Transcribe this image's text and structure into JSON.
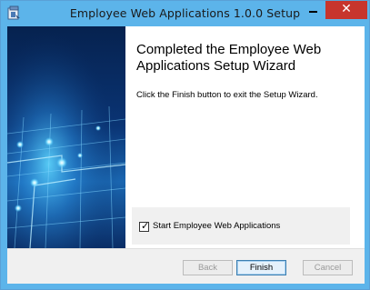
{
  "window": {
    "title": "Employee Web Applications 1.0.0 Setup",
    "close_symbol": "✕"
  },
  "content": {
    "title": "Completed the Employee Web Applications Setup Wizard",
    "description": "Click the Finish button to exit the Setup Wizard."
  },
  "launch_option": {
    "label": "Start Employee Web Applications",
    "checked": true,
    "check_mark": "✓"
  },
  "buttons": {
    "back": "Back",
    "finish": "Finish",
    "cancel": "Cancel"
  },
  "colors": {
    "titlebar": "#5cb4ea",
    "close": "#c7352d",
    "banner_dark": "#0a2a5e",
    "banner_glow": "#35c2ff"
  },
  "icons": [
    "installer-icon",
    "minimize-icon",
    "close-icon",
    "checkbox-check-icon"
  ]
}
